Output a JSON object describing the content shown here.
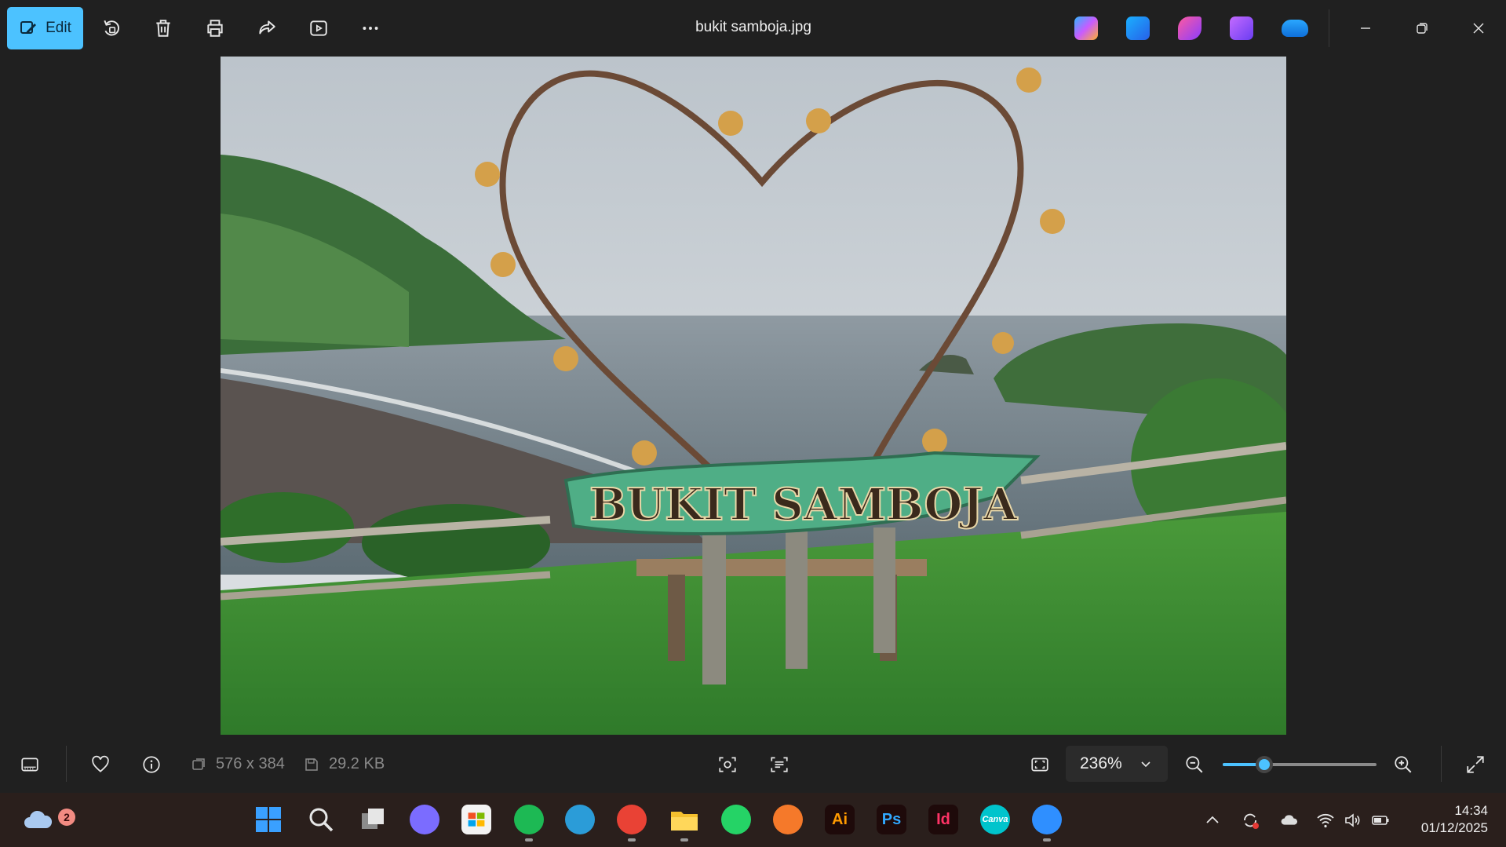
{
  "toolbar": {
    "edit_label": "Edit",
    "buttons": [
      "rotate",
      "delete",
      "print",
      "share",
      "slideshow",
      "more"
    ],
    "title": "bukit samboja.jpg",
    "apps": [
      {
        "name": "copilot",
        "color": "#7b6cff"
      },
      {
        "name": "photos-editor",
        "color": "#2f8fff"
      },
      {
        "name": "designer",
        "color": "#c43dff"
      },
      {
        "name": "clipchamp",
        "color": "#8b5cf6"
      },
      {
        "name": "onedrive",
        "color": "#1e90ff"
      }
    ]
  },
  "photo": {
    "sign_text": "BUKIT SAMBOJA"
  },
  "statusbar": {
    "dimensions": "576 x 384",
    "file_size": "29.2 KB",
    "zoom": "236%",
    "zoom_slider_fraction": 0.27
  },
  "taskbar": {
    "weather_badge": "2",
    "apps": [
      {
        "name": "start",
        "label": "",
        "color": "#3aa0ff"
      },
      {
        "name": "search",
        "label": "",
        "color": "#e6e6e6"
      },
      {
        "name": "task-view",
        "label": "",
        "color": "#cfcfcf"
      },
      {
        "name": "copilot",
        "label": "",
        "color": "#7b6cff"
      },
      {
        "name": "microsoft-store",
        "label": "",
        "color": "#f3f3f3"
      },
      {
        "name": "spotify",
        "label": "",
        "color": "#1db954"
      },
      {
        "name": "edge",
        "label": "",
        "color": "#2b9cd8"
      },
      {
        "name": "chrome",
        "label": "",
        "color": "#e94235"
      },
      {
        "name": "file-explorer",
        "label": "",
        "color": "#f5c02e"
      },
      {
        "name": "whatsapp",
        "label": "",
        "color": "#25d366"
      },
      {
        "name": "blender",
        "label": "",
        "color": "#f5792a"
      },
      {
        "name": "illustrator",
        "label": "Ai",
        "color": "#ff9a00"
      },
      {
        "name": "photoshop",
        "label": "Ps",
        "color": "#31a8ff"
      },
      {
        "name": "indesign",
        "label": "Id",
        "color": "#ff3366"
      },
      {
        "name": "canva",
        "label": "Canva",
        "color": "#00c4cc"
      },
      {
        "name": "photos",
        "label": "",
        "color": "#2f8fff"
      }
    ],
    "clock": {
      "time": "14:34",
      "date": "01/12/2025"
    }
  },
  "accent_color": "#4cc2ff"
}
